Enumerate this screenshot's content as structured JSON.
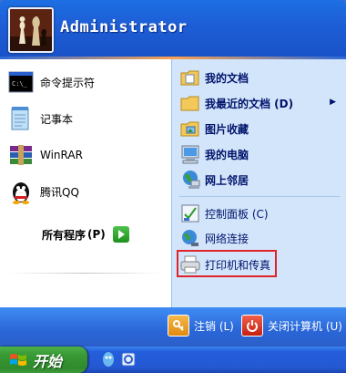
{
  "header": {
    "username": "Administrator"
  },
  "left_items": [
    {
      "label": "命令提示符",
      "icon": "cmd-icon"
    },
    {
      "label": "记事本",
      "icon": "notepad-icon"
    },
    {
      "label": "WinRAR",
      "icon": "winrar-icon"
    },
    {
      "label": "腾讯QQ",
      "icon": "qq-icon"
    }
  ],
  "all_programs": {
    "label": "所有程序 (P)",
    "label_main": "所有程序",
    "label_key": "(P)"
  },
  "right_items": [
    {
      "label": "我的文档",
      "icon": "my-documents-icon"
    },
    {
      "label": "我最近的文档 (D)",
      "icon": "recent-documents-icon"
    },
    {
      "label": "图片收藏",
      "icon": "my-pictures-icon"
    },
    {
      "label": "我的电脑",
      "icon": "my-computer-icon"
    },
    {
      "label": "网上邻居",
      "icon": "network-places-icon"
    },
    {
      "label": "控制面板 (C)",
      "icon": "control-panel-icon"
    },
    {
      "label": "网络连接",
      "icon": "network-connections-icon"
    },
    {
      "label": "打印机和传真",
      "icon": "printers-icon"
    }
  ],
  "footer": {
    "logoff": "注销 (L)",
    "shutdown": "关闭计算机 (U)"
  },
  "taskbar": {
    "start_label": "开始"
  },
  "colors": {
    "highlight": "#e0242a",
    "header": "#1d5fd7",
    "right_panel": "#d3e5fa",
    "start_green": "#3a9a36"
  }
}
